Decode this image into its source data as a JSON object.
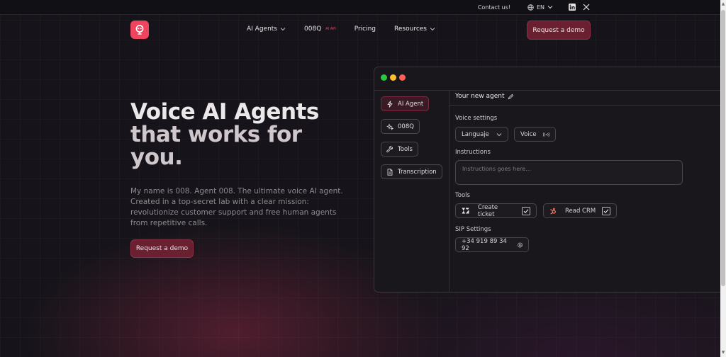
{
  "topbar": {
    "contact": "Contact us!",
    "language": "EN"
  },
  "nav": {
    "items": [
      {
        "label": "AI Agents",
        "dropdown": true
      },
      {
        "label": "008Q",
        "tag": "AI API"
      },
      {
        "label": "Pricing"
      },
      {
        "label": "Resources",
        "dropdown": true
      }
    ],
    "cta": "Request a demo"
  },
  "hero": {
    "title_line1": "Voice AI Agents",
    "title_line2": "that works for",
    "title_line3": "you.",
    "description": "My name is 008. Agent 008. The ultimate voice AI agent. Created in a top-secret lab with a clear mission: revolutionize customer support and free human agents from repetitive calls.",
    "cta": "Request a demo"
  },
  "panel": {
    "sidebar": [
      {
        "label": "AI Agent",
        "icon": "lightning-icon",
        "active": true
      },
      {
        "label": "008Q",
        "icon": "sparkles-icon"
      },
      {
        "label": "Tools",
        "icon": "wrench-icon"
      },
      {
        "label": "Transcription",
        "icon": "document-icon"
      }
    ],
    "agent_name": "Your new agent",
    "voice_settings": {
      "label": "Voice settings",
      "language": "Languaje",
      "voice": "Voice"
    },
    "instructions": {
      "label": "Instructions",
      "placeholder": "Instructions goes here..."
    },
    "tools": {
      "label": "Tools",
      "items": [
        {
          "label": "Create ticket",
          "icon": "zendesk-icon",
          "checked": true
        },
        {
          "label": "Read CRM",
          "icon": "hubspot-icon",
          "checked": true
        }
      ]
    },
    "sip": {
      "label": "SIP Settings",
      "number": "+34 919 89 34 92"
    }
  },
  "colors": {
    "accent": "#f0435e",
    "button": "#6a2030",
    "background": "#16141a"
  }
}
